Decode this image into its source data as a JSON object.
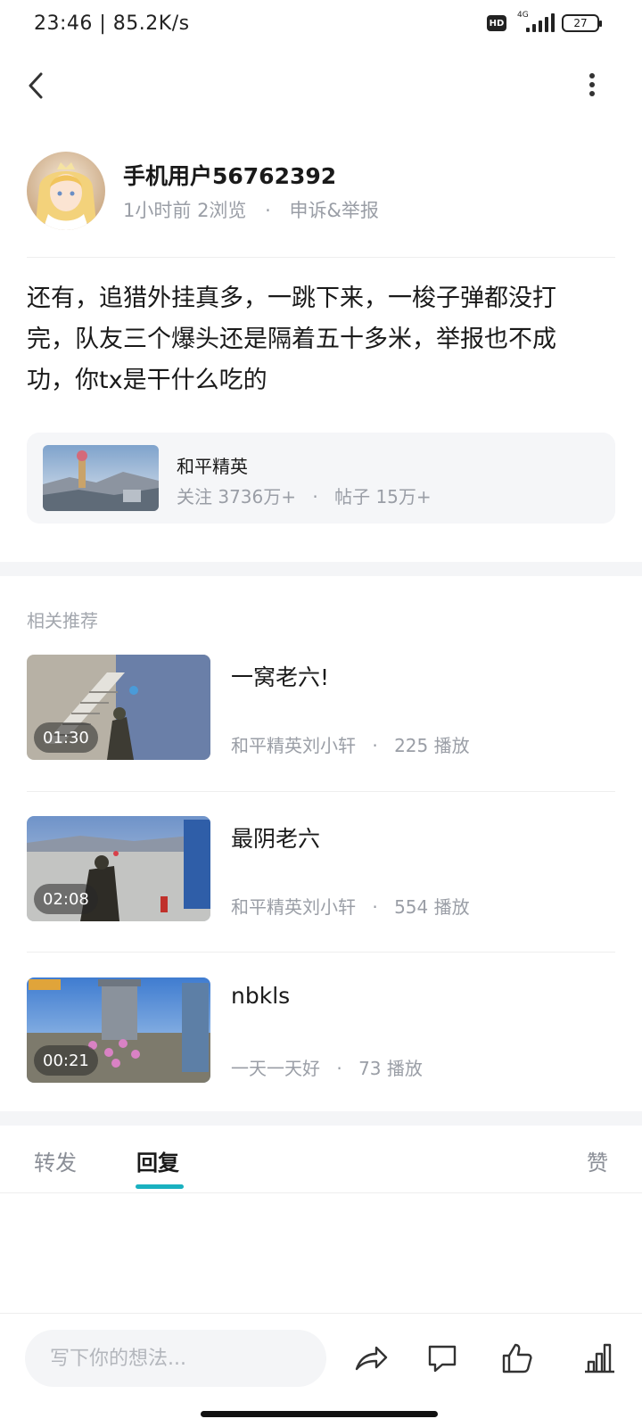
{
  "status_bar": {
    "time_speed": "23:46 | 85.2K/s",
    "hd": "HD",
    "network": "4G",
    "battery": "27"
  },
  "nav": {
    "back_icon": "back-chevron-icon",
    "more_icon": "more-vertical-icon"
  },
  "author": {
    "name": "手机用户56762392",
    "time": "1小时前",
    "views": "2浏览",
    "separator": "·",
    "report": "申诉&举报"
  },
  "post": {
    "body": "还有，追猎外挂真多，一跳下来，一梭子弹都没打完，队友三个爆头还是隔着五十多米，举报也不成功，你tx是干什么吃的"
  },
  "topic": {
    "title": "和平精英",
    "followers": "关注 3736万+",
    "separator": "·",
    "posts": "帖子 15万+"
  },
  "recommend": {
    "header": "相关推荐",
    "items": [
      {
        "duration": "01:30",
        "title": "一窝老六!",
        "author": "和平精英刘小轩",
        "separator": "·",
        "plays": "225 播放"
      },
      {
        "duration": "02:08",
        "title": "最阴老六",
        "author": "和平精英刘小轩",
        "separator": "·",
        "plays": "554 播放"
      },
      {
        "duration": "00:21",
        "title": "nbkls",
        "author": "一天一天好",
        "separator": "·",
        "plays": "73 播放"
      }
    ]
  },
  "tabs": {
    "forward": "转发",
    "reply": "回复",
    "like": "赞",
    "active": "回复"
  },
  "bottom_bar": {
    "placeholder": "写下你的想法...",
    "icons": [
      "share-icon",
      "comment-icon",
      "like-icon",
      "stats-icon"
    ]
  },
  "colors": {
    "accent": "#1ab1c0",
    "muted_text": "#9a9ea6",
    "card_bg": "#f5f6f8"
  }
}
